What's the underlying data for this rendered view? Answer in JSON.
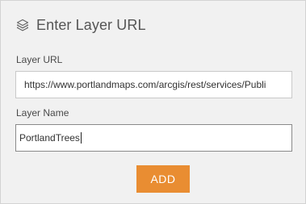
{
  "header": {
    "icon": "layers-icon",
    "title": "Enter Layer URL"
  },
  "form": {
    "layer_url_label": "Layer URL",
    "layer_url_value": "https://www.portlandmaps.com/arcgis/rest/services/Publi",
    "layer_name_label": "Layer Name",
    "layer_name_value": "PortlandTrees"
  },
  "actions": {
    "add_label": "ADD"
  },
  "colors": {
    "accent": "#e98d32",
    "background": "#f1f1f1"
  }
}
